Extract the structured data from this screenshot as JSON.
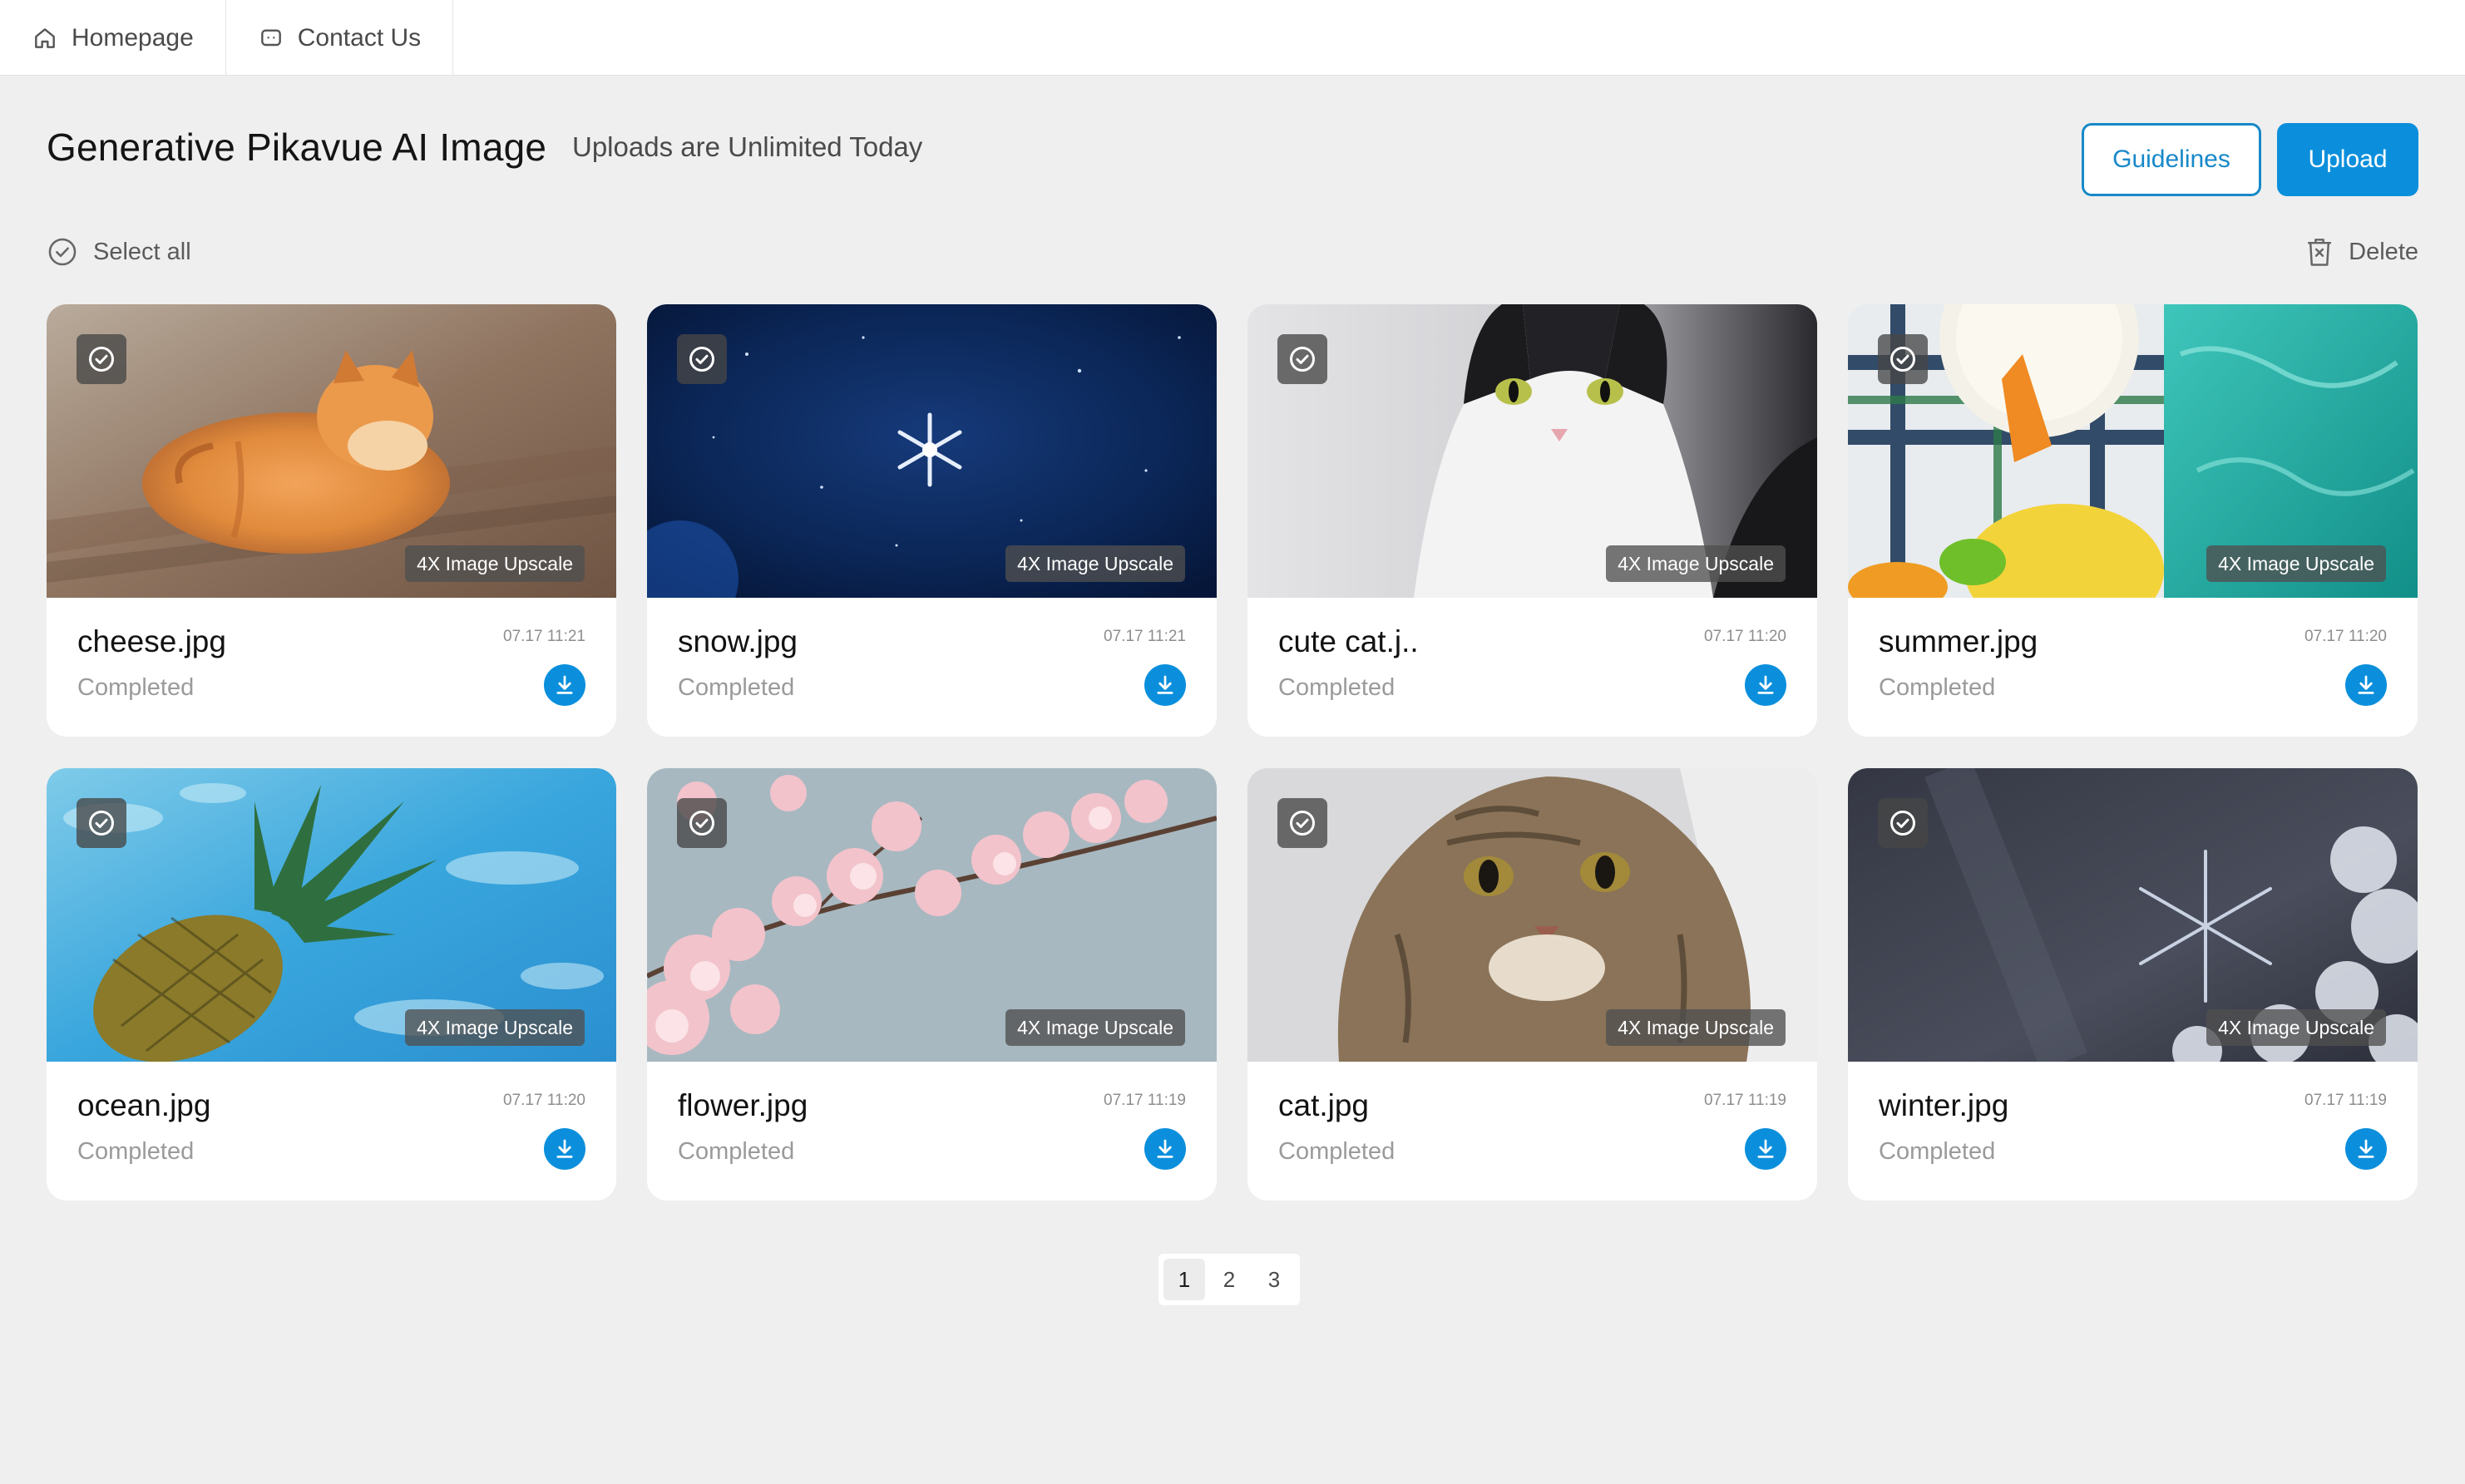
{
  "nav": {
    "tabs": [
      {
        "label": "Homepage",
        "icon": "home-icon"
      },
      {
        "label": "Contact Us",
        "icon": "chat-icon"
      }
    ]
  },
  "header": {
    "title": "Generative Pikavue AI Image",
    "subtitle": "Uploads are Unlimited Today",
    "guidelines_label": "Guidelines",
    "upload_label": "Upload"
  },
  "toolbar": {
    "select_all_label": "Select all",
    "delete_label": "Delete"
  },
  "cards": [
    {
      "name": "cheese.jpg",
      "status": "Completed",
      "time": "07.17 11:21",
      "badge": "4X Image Upscale",
      "image": "orange-tabby-cat-on-floor"
    },
    {
      "name": "snow.jpg",
      "status": "Completed",
      "time": "07.17 11:21",
      "badge": "4X Image Upscale",
      "image": "snowflake-on-dark-blue"
    },
    {
      "name": "cute cat.j..",
      "status": "Completed",
      "time": "07.17 11:20",
      "badge": "4X Image Upscale",
      "image": "black-white-cat"
    },
    {
      "name": "summer.jpg",
      "status": "Completed",
      "time": "07.17 11:20",
      "badge": "4X Image Upscale",
      "image": "drink-by-pool"
    },
    {
      "name": "ocean.jpg",
      "status": "Completed",
      "time": "07.17 11:20",
      "badge": "4X Image Upscale",
      "image": "pineapple-in-water"
    },
    {
      "name": "flower.jpg",
      "status": "Completed",
      "time": "07.17 11:19",
      "badge": "4X Image Upscale",
      "image": "cherry-blossoms"
    },
    {
      "name": "cat.jpg",
      "status": "Completed",
      "time": "07.17 11:19",
      "badge": "4X Image Upscale",
      "image": "tabby-kitten"
    },
    {
      "name": "winter.jpg",
      "status": "Completed",
      "time": "07.17 11:19",
      "badge": "4X Image Upscale",
      "image": "frost-crystals"
    }
  ],
  "pagination": {
    "pages": [
      "1",
      "2",
      "3"
    ],
    "current": "1"
  },
  "colors": {
    "accent": "#0b8fdc",
    "background": "#efefef",
    "card": "#ffffff"
  }
}
